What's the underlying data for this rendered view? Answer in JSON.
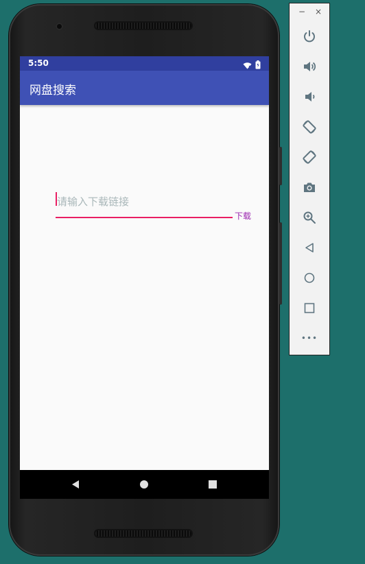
{
  "status_bar": {
    "time": "5:50",
    "icons": [
      "wifi-icon",
      "battery-icon"
    ]
  },
  "app_bar": {
    "title": "网盘搜索"
  },
  "form": {
    "link_input": {
      "placeholder": "请输入下载链接",
      "value": ""
    },
    "download_label": "下载"
  },
  "nav_bar": {
    "buttons": [
      "back-icon",
      "home-icon",
      "recents-icon"
    ]
  },
  "emulator_toolbar": {
    "window_controls": {
      "minimize": "−",
      "close": "×"
    },
    "tools": [
      "power-icon",
      "volume-up-icon",
      "volume-down-icon",
      "rotate-left-icon",
      "rotate-right-icon",
      "camera-icon",
      "zoom-icon",
      "back-icon",
      "home-icon",
      "overview-icon",
      "more-icon"
    ],
    "more_label": "•••"
  },
  "colors": {
    "background": "#1d6f6b",
    "status_bar": "#303f9f",
    "app_bar": "#3f51b5",
    "accent": "#e91e63",
    "button_text": "#9c27b0",
    "placeholder": "#a9b7b9",
    "toolbar_icon": "#5f7580"
  }
}
